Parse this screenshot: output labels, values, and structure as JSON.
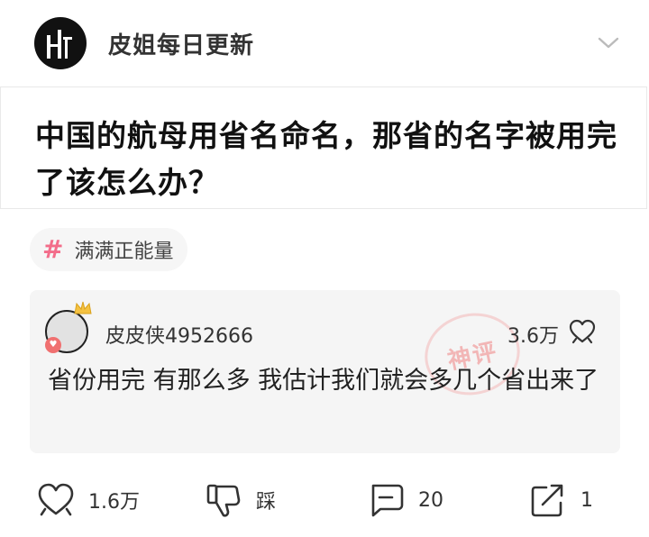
{
  "header": {
    "author_name": "皮姐每日更新"
  },
  "post": {
    "title": "中国的航母用省名命名，那省的名字被用完了该怎么办？",
    "tag": {
      "label": "满满正能量",
      "accent_color": "#f36d8a"
    }
  },
  "comment": {
    "user_name": "皮皮侠4952666",
    "likes": "3.6万",
    "text": "省份用完 有那么多 我估计我们就会多几个省出来了",
    "stamp": "神评"
  },
  "actions": {
    "like_count": "1.6万",
    "dislike_label": "踩",
    "comment_count": "20",
    "share_count": "1"
  }
}
